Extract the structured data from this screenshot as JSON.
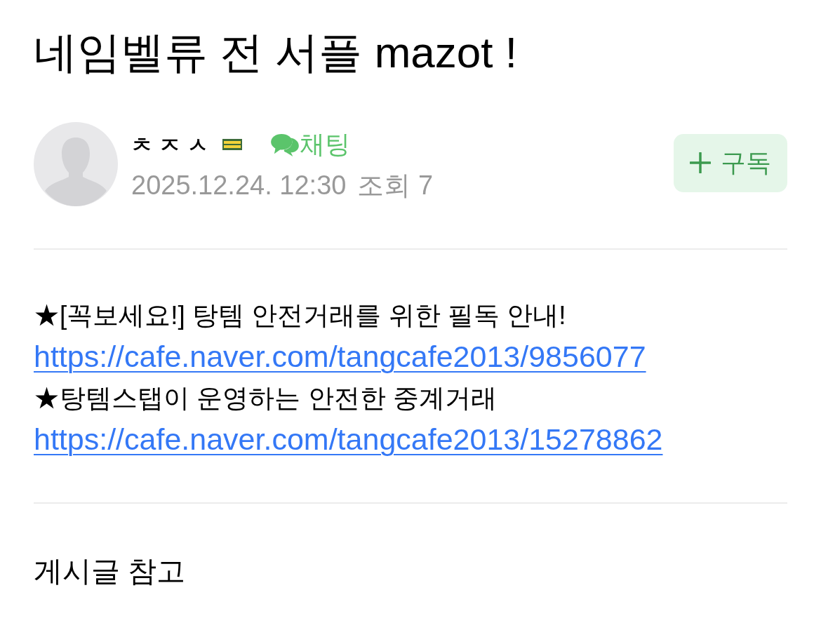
{
  "post": {
    "title": "네임벨류 전 서플 mazot !"
  },
  "author": {
    "name": "ㅊㅈㅅ",
    "chat_label": "채팅",
    "date": "2025.12.24. 12:30",
    "views": "조회 7"
  },
  "subscribe_button": {
    "label": "구독"
  },
  "body": {
    "lines": [
      {
        "kind": "text",
        "text": "★[꼭보세요!] 탕템 안전거래를 위한 필독 안내!"
      },
      {
        "kind": "link",
        "text": "https://cafe.naver.com/tangcafe2013/9856077"
      },
      {
        "kind": "text",
        "text": "★탕템스탭이 운영하는 안전한 중계거래"
      },
      {
        "kind": "link",
        "text": "https://cafe.naver.com/tangcafe2013/15278862"
      }
    ]
  },
  "footer_text": "게시글 참고"
}
